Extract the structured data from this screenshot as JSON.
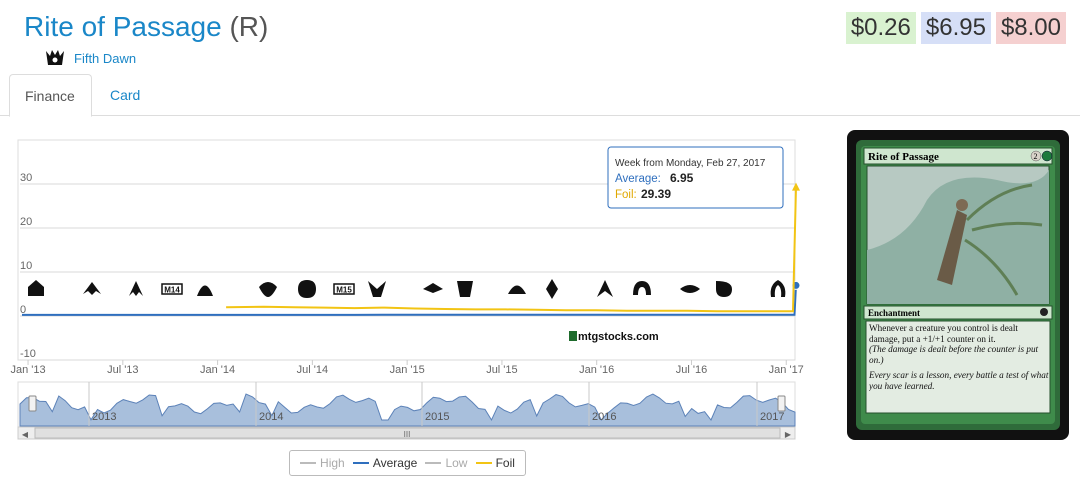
{
  "header": {
    "card_name": "Rite of Passage",
    "rarity": "(R)",
    "set_name": "Fifth Dawn",
    "set_icon": "fifth-dawn-set-icon"
  },
  "prices": [
    {
      "label": "$0.26",
      "bg": "#d9f2d0"
    },
    {
      "label": "$6.95",
      "bg": "#d6dff7"
    },
    {
      "label": "$8.00",
      "bg": "#f5d0d0"
    }
  ],
  "tabs": [
    {
      "label": "Finance",
      "active": true
    },
    {
      "label": "Card",
      "active": false
    }
  ],
  "tooltip": {
    "heading": "Week from Monday, Feb 27, 2017",
    "avg_label": "Average:",
    "avg_value": "6.95",
    "foil_label": "Foil:",
    "foil_value": "29.39"
  },
  "watermark": "mtgstocks.com",
  "navigator": {
    "years": [
      "2013",
      "2014",
      "2015",
      "2016",
      "2017"
    ],
    "scroll_grip": "III"
  },
  "legend": [
    {
      "label": "High",
      "color": "#bbbbbb",
      "dim": true
    },
    {
      "label": "Average",
      "color": "#2f6fbe",
      "dim": false
    },
    {
      "label": "Low",
      "color": "#bbbbbb",
      "dim": true
    },
    {
      "label": "Foil",
      "color": "#f2c414",
      "dim": false
    }
  ],
  "card_image": {
    "title": "Rite of Passage",
    "mana": "2",
    "type_line": "Enchantment",
    "rules": "Whenever a creature you control is dealt damage, put a +1/+1 counter on it.",
    "reminder": "(The damage is dealt before the counter is put on.)",
    "flavor": "Every scar is a lesson, every battle a test of what you have learned."
  },
  "chart_data": {
    "type": "line",
    "x_ticks": [
      "Jan '13",
      "Jul '13",
      "Jan '14",
      "Jul '14",
      "Jan '15",
      "Jul '15",
      "Jan '16",
      "Jul '16",
      "Jan '17"
    ],
    "y_ticks": [
      "-10",
      "0",
      "10",
      "20",
      "30"
    ],
    "ylim": [
      -10,
      40
    ],
    "grid": true,
    "set_symbols": [
      "gatecrash",
      "dragons-maze",
      "m14",
      "theros",
      "born-of-the-gods",
      "journey-into-nyx",
      "m15",
      "khans",
      "fate-reforged",
      "dragons-of-tarkir",
      "magic-origins",
      "bfz",
      "oath",
      "soi",
      "emn",
      "kaladesh",
      "aether-revolt"
    ],
    "series": [
      {
        "name": "Average",
        "color": "#2f6fbe",
        "x": [
          0,
          2,
          4,
          6,
          8,
          10,
          12,
          14,
          16,
          18,
          20,
          22,
          24,
          26,
          28,
          30,
          32,
          34,
          35,
          36,
          37,
          38,
          40,
          42,
          44,
          46,
          48,
          50,
          51,
          51.1,
          51.2
        ],
        "y": [
          0.25,
          0.25,
          0.25,
          0.25,
          0.25,
          0.25,
          0.25,
          0.25,
          0.25,
          0.25,
          0.25,
          0.25,
          0.3,
          0.3,
          0.3,
          0.3,
          0.3,
          0.3,
          0.3,
          0.3,
          0.3,
          0.3,
          0.3,
          0.3,
          0.3,
          0.3,
          0.3,
          0.3,
          0.3,
          0.3,
          6.95
        ]
      },
      {
        "name": "Foil",
        "color": "#f2c414",
        "x": [
          13.5,
          16,
          18,
          20,
          22,
          24,
          26,
          28,
          30,
          32,
          34,
          36,
          38,
          40,
          42,
          44,
          46,
          48,
          50,
          51,
          51.2
        ],
        "y": [
          2.0,
          2.1,
          2.0,
          1.9,
          1.8,
          1.9,
          1.7,
          1.6,
          1.5,
          1.5,
          1.4,
          1.3,
          1.3,
          1.2,
          1.2,
          1.2,
          1.1,
          1.1,
          1.1,
          1.1,
          29.39
        ]
      }
    ]
  }
}
